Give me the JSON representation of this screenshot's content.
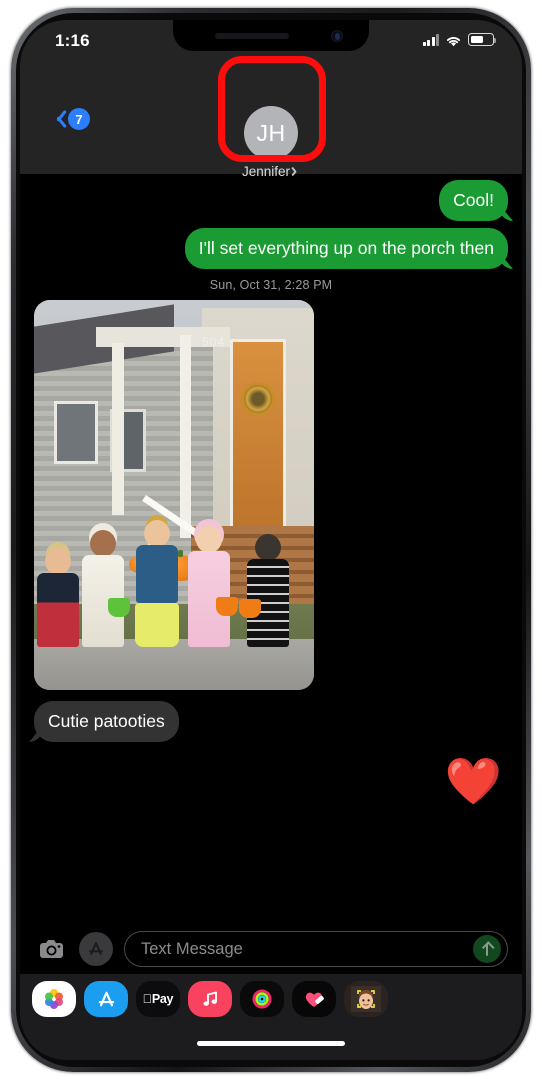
{
  "status_bar": {
    "time": "1:16",
    "signal_icon": "cellular-signal-icon",
    "wifi_icon": "wifi-icon",
    "battery_icon": "battery-icon",
    "battery_level_pct": 58
  },
  "nav": {
    "back_icon": "back-chevron-icon",
    "back_badge_count": "7",
    "contact": {
      "avatar_initials": "JH",
      "name": "Jennifer",
      "disclosure_icon": "chevron-right-icon"
    }
  },
  "annotation": {
    "shape": "rounded-rectangle-highlight",
    "color": "#fd0d0d",
    "target": "contact-avatar-and-name"
  },
  "conversation": {
    "messages": [
      {
        "id": "m1",
        "side": "out",
        "type": "text",
        "text": "Cool!",
        "color": "#1a9b34"
      },
      {
        "id": "m2",
        "side": "out",
        "type": "text",
        "text": "I'll set everything up on the porch then",
        "color": "#1a9b34"
      }
    ],
    "timestamp_divider": "Sun, Oct 31, 2:28 PM",
    "photo_message": {
      "side": "in",
      "type": "photo",
      "alt": "Five children in Halloween costumes standing in front of a house porch with pumpkins",
      "house_number": "504"
    },
    "caption_message": {
      "id": "m3",
      "side": "in",
      "type": "text",
      "text": "Cutie patooties",
      "color": "#333334"
    },
    "reaction_message": {
      "id": "m4",
      "side": "out",
      "type": "emoji",
      "text": "❤️"
    }
  },
  "input_bar": {
    "camera_icon": "camera-icon",
    "apps_icon": "app-store-icon",
    "placeholder": "Text Message",
    "value": "",
    "send_icon": "send-arrow-icon"
  },
  "app_drawer": {
    "items": [
      {
        "name": "photos-app-icon",
        "label": "Photos",
        "bg": "#ffffff"
      },
      {
        "name": "app-store-app-icon",
        "label": "App Store",
        "bg": "#1b9df0"
      },
      {
        "name": "apple-pay-app-icon",
        "label": "Pay",
        "bg": "#000000"
      },
      {
        "name": "music-app-icon",
        "label": "Music",
        "bg": "#f8425f"
      },
      {
        "name": "fitness-app-icon",
        "label": "Fitness",
        "bg": "#0a0a0a"
      },
      {
        "name": "digital-touch-app-icon",
        "label": "Digital Touch",
        "bg": "#070707"
      },
      {
        "name": "memoji-app-icon",
        "label": "Memoji",
        "bg": "#2b2320"
      }
    ]
  },
  "home_indicator": "home-indicator-bar"
}
